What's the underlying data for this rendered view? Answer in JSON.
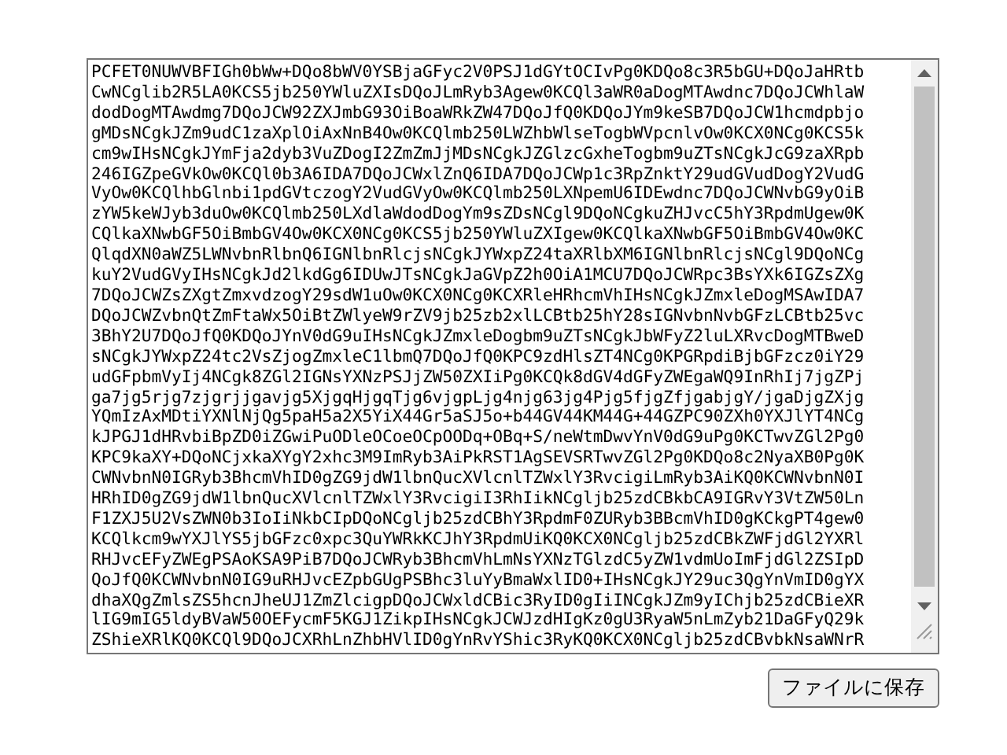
{
  "textarea": {
    "lines": [
      "PCFET0NUWVBFIGh0bWw+DQo8bWV0YSBjaGFyc2V0PSJ1dGYtOCIvPg0KDQo8c3R5bGU+DQoJaHRtb",
      "CwNCglib2R5LA0KCS5jb250YWluZXIsDQoJLmRyb3Agew0KCQl3aWR0aDogMTAwdnc7DQoJCWhlaW",
      "dodDogMTAwdmg7DQoJCW92ZXJmbG93OiBoaWRkZW47DQoJfQ0KDQoJYm9keSB7DQoJCW1hcmdpbjo",
      "gMDsNCgkJZm9udC1zaXplOiAxNnB4Ow0KCQlmb250LWZhbWlseTogbWVpcnlvOw0KCX0NCg0KCS5k",
      "cm9wIHsNCgkJYmFja2dyb3VuZDogI2ZmZmJjMDsNCgkJZGlzcGxheTogbm9uZTsNCgkJcG9zaXRpb",
      "246IGZpeGVkOw0KCQl0b3A6IDA7DQoJCWxlZnQ6IDA7DQoJCWp1c3RpZnktY29udGVudDogY2VudG",
      "VyOw0KCQlhbGlnbi1pdGVtczogY2VudGVyOw0KCQlmb250LXNpemU6IDEwdnc7DQoJCWNvbG9yOiB",
      "zYW5keWJyb3duOw0KCQlmb250LXdlaWdodDogYm9sZDsNCgl9DQoNCgkuZHJvcC5hY3RpdmUgew0K",
      "CQlkaXNwbGF5OiBmbGV4Ow0KCX0NCg0KCS5jb250YWluZXIgew0KCQlkaXNwbGF5OiBmbGV4Ow0KC",
      "QlqdXN0aWZ5LWNvbnRlbnQ6IGNlbnRlcjsNCgkJYWxpZ24taXRlbXM6IGNlbnRlcjsNCgl9DQoNCg",
      "kuY2VudGVyIHsNCgkJd2lkdGg6IDUwJTsNCgkJaGVpZ2h0OiA1MCU7DQoJCWRpc3BsYXk6IGZsZXg",
      "7DQoJCWZsZXgtZmxvdzogY29sdW1uOw0KCX0NCg0KCXRleHRhcmVhIHsNCgkJZmxleDogMSAwIDA7",
      "DQoJCWZvbnQtZmFtaWx5OiBtZWlyeW9rZV9jb25zb2xlLCBtb25hY28sIGNvbnNvbGFzLCBtb25vc",
      "3BhY2U7DQoJfQ0KDQoJYnV0dG9uIHsNCgkJZmxleDogbm9uZTsNCgkJbWFyZ2luLXRvcDogMTBweD",
      "sNCgkJYWxpZ24tc2VsZjogZmxleC1lbmQ7DQoJfQ0KPC9zdHlsZT4NCg0KPGRpdiBjbGFzcz0iY29",
      "udGFpbmVyIj4NCgk8ZGl2IGNsYXNzPSJjZW50ZXIiPg0KCQk8dGV4dGFyZWEgaWQ9InRhIj7jgZPj",
      "ga7jg5rjg7zjgrjjgavjg5XjgqHjgqTjg6vjgpLjg4njg63jg4Pjg5fjgZfjgabjgY/jgaDjgZXjg",
      "YQmIzAxMDtiYXNlNjQg5paH5a2X5YiX44Gr5aSJ5o+b44GV44KM44G+44GZPC90ZXh0YXJlYT4NCg",
      "kJPGJ1dHRvbiBpZD0iZGwiPuODleOCoeOCpOODq+OBq+S/neWtmDwvYnV0dG9uPg0KCTwvZGl2Pg0",
      "KPC9kaXY+DQoNCjxkaXYgY2xhc3M9ImRyb3AiPkRST1AgSEVSRTwvZGl2Pg0KDQo8c2NyaXB0Pg0K",
      "CWNvbnN0IGRyb3BhcmVhID0gZG9jdW1lbnQucXVlcnlTZWxlY3RvcigiLmRyb3AiKQ0KCWNvbnN0I",
      "HRhID0gZG9jdW1lbnQucXVlcnlTZWxlY3RvcigiI3RhIikNCgljb25zdCBkbCA9IGRvY3VtZW50Ln",
      "F1ZXJ5U2VsZWN0b3IoIiNkbCIpDQoNCgljb25zdCBhY3RpdmF0ZURyb3BBcmVhID0gKCkgPT4gew0",
      "KCQlkcm9wYXJlYS5jbGFzc0xpc3QuYWRkKCJhY3RpdmUiKQ0KCX0NCgljb25zdCBkZWFjdGl2YXRl",
      "RHJvcEFyZWEgPSAoKSA9PiB7DQoJCWRyb3BhcmVhLmNsYXNzTGlzdC5yZW1vdmUoImFjdGl2ZSIpD",
      "QoJfQ0KCWNvbnN0IG9uRHJvcEZpbGUgPSBhc3luYyBmaWxlID0+IHsNCgkJY29uc3QgYnVmID0gYX",
      "dhaXQgZmlsZS5hcnJheUJ1ZmZlcigpDQoJCWxldCBic3RyID0gIiINCgkJZm9yIChjb25zdCBieXR",
      "lIG9mIG5ldyBVaW50OEFycmF5KGJ1ZikpIHsNCgkJCWJzdHIgKz0gU3RyaW5nLmZyb21DaGFyQ29k",
      "ZShieXRlKQ0KCQl9DQoJCXRhLnZhbHVlID0gYnRvYShic3RyKQ0KCX0NCgljb25zdCBvbkNsaWNrR"
    ]
  },
  "button": {
    "label": "ファイルに保存"
  }
}
